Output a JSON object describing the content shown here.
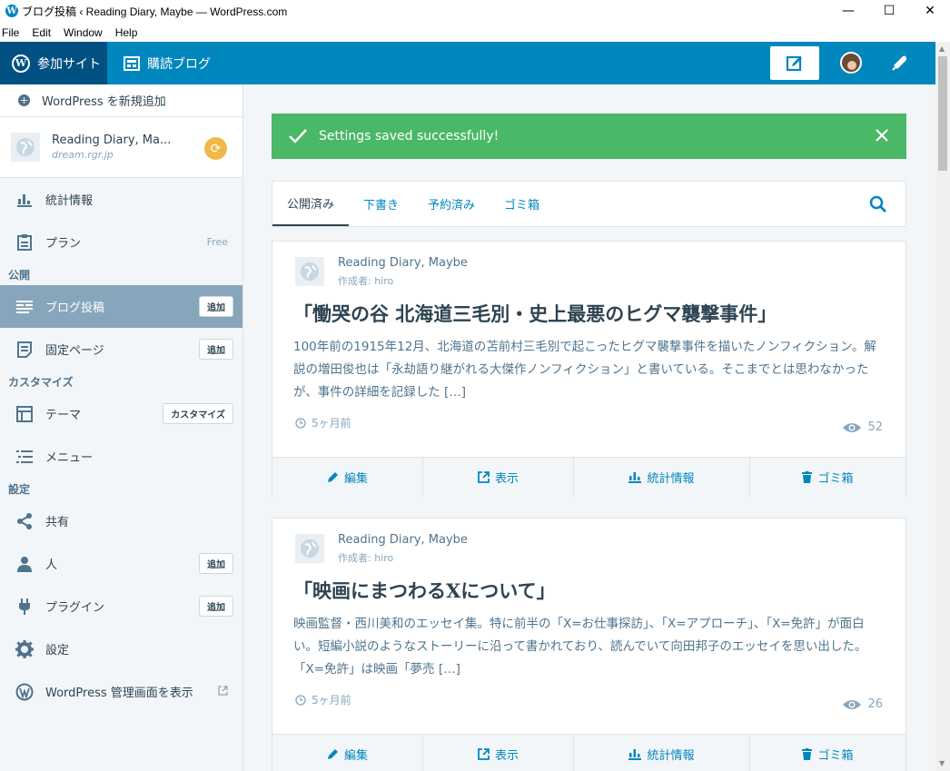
{
  "window": {
    "title": "ブログ投稿 ‹ Reading Diary, Maybe — WordPress.com",
    "minimize": "—",
    "maximize": "☐",
    "close": "✕"
  },
  "menubar": [
    "File",
    "Edit",
    "Window",
    "Help"
  ],
  "topbar": {
    "my_sites": "参加サイト",
    "reader": "購読ブログ"
  },
  "sidebar": {
    "add_site": "WordPress を新規追加",
    "site_name": "Reading Diary, Ma...",
    "site_url": "dream.rgr.jp",
    "stats": "統計情報",
    "plan": "プラン",
    "plan_badge": "Free",
    "section_publish": "公開",
    "posts": "ブログ投稿",
    "posts_add": "追加",
    "pages": "固定ページ",
    "pages_add": "追加",
    "section_customize": "カスタマイズ",
    "themes": "テーマ",
    "themes_customize": "カスタマイズ",
    "menus": "メニュー",
    "section_settings": "設定",
    "sharing": "共有",
    "people": "人",
    "people_add": "追加",
    "plugins": "プラグイン",
    "plugins_add": "追加",
    "settings": "設定",
    "wp_admin": "WordPress 管理画面を表示"
  },
  "notice": {
    "text": "Settings saved successfully!"
  },
  "tabs": [
    "公開済み",
    "下書き",
    "予約済み",
    "ゴミ箱"
  ],
  "posts": [
    {
      "site": "Reading Diary, Maybe",
      "author": "作成者: hiro",
      "title": "「慟哭の谷 北海道三毛別・史上最悪のヒグマ襲撃事件」",
      "excerpt": "100年前の1915年12月、北海道の苫前村三毛別で起こったヒグマ襲撃事件を描いたノンフィクション。解説の増田俊也は「永劫語り継がれる大傑作ノンフィクション」と書いている。そこまでとは思わなかったが、事件の詳細を記録した […]",
      "time": "5ヶ月前",
      "views": "52"
    },
    {
      "site": "Reading Diary, Maybe",
      "author": "作成者: hiro",
      "title": "「映画にまつわるXについて」",
      "excerpt": "映画監督・西川美和のエッセイ集。特に前半の「X=お仕事探訪」、「X=アプローチ」、「X=免許」が面白い。短編小説のようなストーリーに沿って書かれており、読んでいて向田邦子のエッセイを思い出した。「X=免許」は映画「夢売 […]",
      "time": "5ヶ月前",
      "views": "26"
    }
  ],
  "actions": {
    "edit": "編集",
    "view": "表示",
    "stats": "統計情報",
    "trash": "ゴミ箱"
  },
  "colors": {
    "accent": "#0087be",
    "dark_accent": "#005082",
    "success": "#4ab866",
    "sidebar_active": "#87a6bc",
    "text": "#2e4453"
  }
}
